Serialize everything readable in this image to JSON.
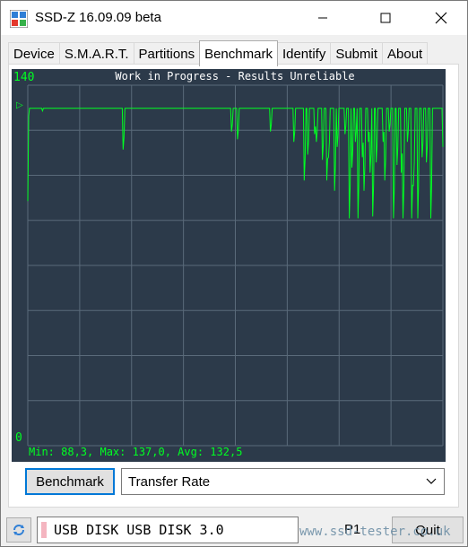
{
  "window": {
    "title": "SSD-Z 16.09.09 beta"
  },
  "tabs": [
    {
      "label": "Device"
    },
    {
      "label": "S.M.A.R.T."
    },
    {
      "label": "Partitions"
    },
    {
      "label": "Benchmark",
      "active": true
    },
    {
      "label": "Identify"
    },
    {
      "label": "Submit"
    },
    {
      "label": "About"
    }
  ],
  "chart": {
    "y_max_label": "140",
    "y_min_label": "0",
    "banner": "Work in Progress - Results Unreliable",
    "stats": "Min: 88,3, Max: 137,0, Avg: 132,5",
    "marker": "▷"
  },
  "chart_data": {
    "type": "line",
    "title": "Work in Progress - Results Unreliable",
    "ylim": [
      0,
      140
    ],
    "grid": true,
    "series": [
      {
        "values": [
          95,
          128,
          131,
          131,
          131,
          130,
          131,
          131,
          131,
          130,
          131,
          131,
          131,
          130,
          131,
          131,
          131,
          130,
          131,
          131,
          131,
          130,
          131,
          131,
          131,
          130,
          131,
          131,
          131,
          131,
          131,
          131,
          131,
          130,
          131,
          131,
          131,
          131,
          115,
          131,
          131,
          131,
          130,
          131,
          131,
          131,
          131,
          131,
          131,
          131,
          130,
          131,
          131,
          131,
          131,
          131,
          131,
          131,
          131,
          130,
          131,
          131,
          131,
          131,
          131,
          131,
          131,
          131,
          131,
          131,
          131,
          130,
          131,
          131,
          131,
          131,
          131,
          131,
          131,
          131,
          131,
          131,
          131,
          131,
          131,
          131,
          131,
          130,
          131,
          131,
          131,
          131,
          131,
          131,
          131,
          131,
          131,
          131,
          131,
          131,
          131,
          131,
          131,
          131,
          131,
          131,
          131,
          130,
          131,
          131,
          131,
          131,
          131,
          131,
          131,
          131,
          131,
          131,
          131,
          131,
          131,
          131,
          131,
          131,
          131,
          131,
          131,
          131,
          131,
          131,
          131,
          131,
          131,
          131,
          131,
          131,
          131,
          131,
          131,
          131,
          131,
          131,
          131,
          131,
          131,
          131,
          131,
          131,
          131,
          131,
          131,
          131,
          131,
          131,
          131,
          131,
          131,
          131,
          131,
          131,
          131,
          131,
          131,
          131,
          131,
          131,
          131,
          131,
          131,
          131,
          131,
          131,
          131,
          131,
          131,
          131,
          131,
          131,
          131,
          131,
          131,
          131,
          131,
          131,
          131,
          131,
          131,
          131,
          131,
          131,
          131,
          131,
          131,
          131,
          131,
          131,
          131,
          131,
          131,
          131,
          131,
          131,
          131,
          131,
          131,
          131,
          131,
          131,
          131,
          131,
          131,
          131,
          131,
          131,
          131,
          131,
          131,
          131,
          131,
          131,
          131,
          131,
          131,
          131,
          131,
          131,
          131,
          131,
          131,
          131,
          131,
          131,
          131,
          131,
          131,
          131,
          131,
          131,
          131,
          131,
          131,
          131,
          131,
          131,
          131,
          131,
          131,
          131,
          131,
          131,
          131,
          131,
          131,
          131,
          131,
          131,
          131,
          131,
          131,
          131,
          131,
          131,
          131,
          131,
          131,
          131,
          131,
          131,
          131,
          131,
          131,
          131,
          131,
          131,
          131,
          131,
          131,
          131,
          131,
          131,
          131,
          131,
          131,
          131,
          131,
          131,
          131,
          131,
          131,
          131,
          131,
          131,
          131,
          131,
          131,
          131,
          131,
          131,
          131,
          131,
          131,
          131,
          131,
          131,
          131,
          131,
          131,
          131,
          131,
          131,
          131,
          131,
          131,
          131,
          131,
          131,
          131,
          131,
          131,
          131,
          131,
          131,
          131,
          131,
          131,
          131,
          131,
          131,
          131,
          131,
          131,
          131,
          131,
          131,
          131,
          131,
          131,
          131,
          131,
          131,
          131,
          131,
          131,
          131,
          131,
          131,
          131,
          131,
          131,
          131,
          131,
          131,
          131,
          131,
          131,
          131,
          131,
          131,
          131,
          131,
          131,
          131,
          131,
          131,
          131,
          131,
          131,
          131,
          131,
          131,
          131,
          131,
          131,
          131,
          131,
          131,
          131,
          131,
          131,
          131,
          131,
          131,
          131,
          131,
          131,
          131,
          131,
          131,
          131,
          131,
          131,
          131,
          131,
          131,
          131,
          131,
          131,
          131,
          131,
          131,
          131,
          131,
          131,
          131,
          131,
          131,
          131,
          131,
          131,
          131,
          131,
          131,
          131,
          131,
          131,
          131,
          131,
          131,
          131,
          131,
          131,
          131,
          131,
          131,
          131,
          131,
          131,
          131,
          131,
          131,
          131,
          131,
          131,
          131,
          131,
          131,
          131,
          131,
          131,
          131,
          131,
          131,
          131,
          131,
          131,
          131,
          131,
          131,
          131,
          131,
          131,
          131,
          131,
          131,
          131,
          131,
          131,
          131,
          131,
          131,
          131,
          131,
          131,
          131,
          131,
          131,
          131,
          131,
          131,
          131,
          131,
          131,
          131,
          131,
          131,
          131,
          131,
          131,
          131,
          131
        ]
      }
    ],
    "dips": [
      {
        "at": 0.035,
        "value": 130
      },
      {
        "at": 0.04,
        "value": 131
      },
      {
        "at": 0.23,
        "value": 115
      },
      {
        "at": 0.49,
        "value": 122
      },
      {
        "at": 0.505,
        "value": 119
      },
      {
        "at": 0.585,
        "value": 122
      },
      {
        "at": 0.64,
        "value": 118
      },
      {
        "at": 0.665,
        "value": 103
      },
      {
        "at": 0.675,
        "value": 113
      },
      {
        "at": 0.69,
        "value": 121
      },
      {
        "at": 0.695,
        "value": 118
      },
      {
        "at": 0.71,
        "value": 111
      },
      {
        "at": 0.72,
        "value": 103
      },
      {
        "at": 0.725,
        "value": 112
      },
      {
        "at": 0.74,
        "value": 99
      },
      {
        "at": 0.745,
        "value": 116
      },
      {
        "at": 0.765,
        "value": 121
      },
      {
        "at": 0.775,
        "value": 88.3
      },
      {
        "at": 0.78,
        "value": 108
      },
      {
        "at": 0.79,
        "value": 118
      },
      {
        "at": 0.795,
        "value": 88.3
      },
      {
        "at": 0.805,
        "value": 112
      },
      {
        "at": 0.81,
        "value": 99
      },
      {
        "at": 0.82,
        "value": 118
      },
      {
        "at": 0.825,
        "value": 106
      },
      {
        "at": 0.83,
        "value": 89
      },
      {
        "at": 0.84,
        "value": 110
      },
      {
        "at": 0.855,
        "value": 118
      },
      {
        "at": 0.86,
        "value": 103
      },
      {
        "at": 0.87,
        "value": 122
      },
      {
        "at": 0.88,
        "value": 88.3
      },
      {
        "at": 0.89,
        "value": 109
      },
      {
        "at": 0.9,
        "value": 106
      },
      {
        "at": 0.905,
        "value": 88.3
      },
      {
        "at": 0.915,
        "value": 118
      },
      {
        "at": 0.925,
        "value": 88.3
      },
      {
        "at": 0.93,
        "value": 101
      },
      {
        "at": 0.94,
        "value": 88.3
      },
      {
        "at": 0.95,
        "value": 112
      },
      {
        "at": 0.96,
        "value": 110
      },
      {
        "at": 0.97,
        "value": 88.3
      },
      {
        "at": 0.99,
        "value": 131
      },
      {
        "at": 1.0,
        "value": 116
      }
    ],
    "stats": {
      "min": 88.3,
      "max": 137.0,
      "avg": 132.5
    }
  },
  "controls": {
    "benchmark_button": "Benchmark",
    "mode_select": "Transfer Rate"
  },
  "status": {
    "drive": "USB DISK USB DISK 3.0",
    "p_label": "P1",
    "quit_button": "Quit",
    "watermark": "www.ssd-tester.co.uk"
  },
  "colors": {
    "chart_bg": "#2c3a4a",
    "grid": "#5a6a7a",
    "line": "#00ff22",
    "accent": "#0078d7"
  }
}
